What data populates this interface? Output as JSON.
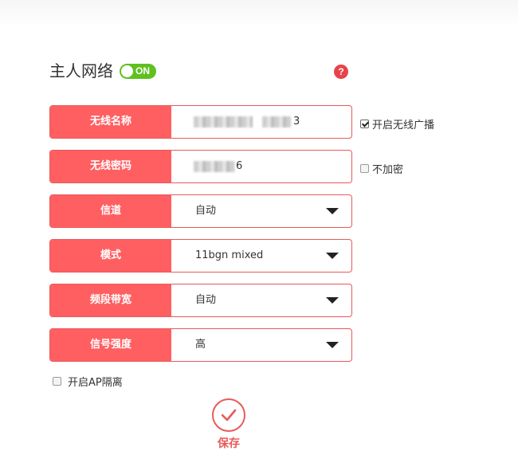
{
  "header": {
    "title": "主人网络",
    "toggle_label": "ON",
    "help_label": "?"
  },
  "fields": {
    "ssid": {
      "label": "无线名称",
      "value_tail": "3"
    },
    "password": {
      "label": "无线密码",
      "value_tail": "6"
    },
    "channel": {
      "label": "信道",
      "value": "自动"
    },
    "mode": {
      "label": "模式",
      "value": "11bgn mixed"
    },
    "bandwidth": {
      "label": "频段带宽",
      "value": "自动"
    },
    "signal": {
      "label": "信号强度",
      "value": "高"
    }
  },
  "options": {
    "broadcast": {
      "label": "开启无线广播",
      "checked": true
    },
    "no_encrypt": {
      "label": "不加密",
      "checked": false
    },
    "ap_isolation": {
      "label": "开启AP隔离",
      "checked": false
    }
  },
  "footer": {
    "save_label": "保存"
  },
  "colors": {
    "accent": "#ff5f61",
    "toggle_on": "#5fc01f",
    "help": "#e9424a"
  }
}
